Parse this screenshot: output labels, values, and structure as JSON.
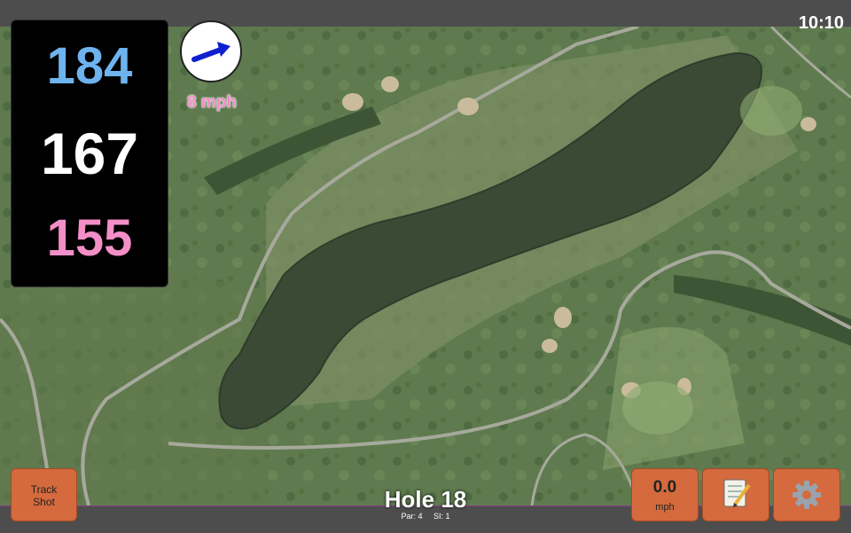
{
  "status": {
    "time": "10:10"
  },
  "yardages": {
    "back": "184",
    "middle": "167",
    "front": "155"
  },
  "wind": {
    "speed_text": "8 mph",
    "direction_icon": "arrow-icon"
  },
  "buttons": {
    "track_shot_line1": "Track",
    "track_shot_line2": "Shot",
    "speed_value": "0.0",
    "speed_unit": "mph",
    "notes_icon": "notepad-icon",
    "settings_icon": "gear-icon"
  },
  "hole": {
    "title": "Hole 18",
    "par": "Par: 4",
    "si": "SI: 1"
  },
  "colors": {
    "back_yardage": "#6fb3ee",
    "front_yardage": "#f38ec7",
    "button": "#d46a3d",
    "accent_border": "#8a3a8a"
  }
}
